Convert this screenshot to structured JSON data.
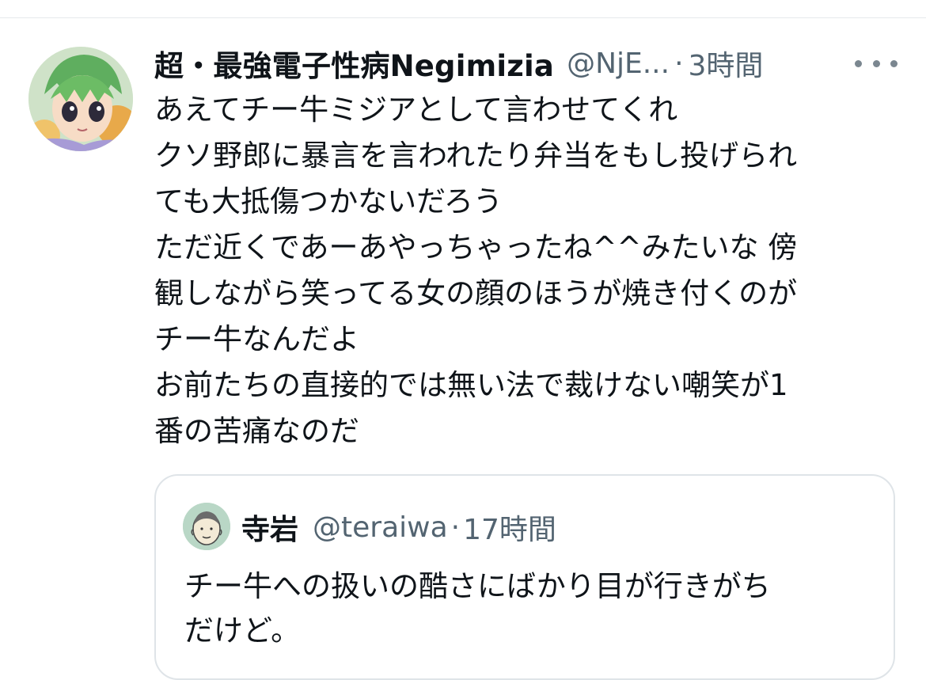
{
  "tweet": {
    "author": {
      "display_name": "超・最強電子性病Negimizia",
      "handle": "@NjE...",
      "avatar_icon": "anime-character-avatar-icon"
    },
    "separator": "·",
    "time": "3時間",
    "more_icon": "more-horizontal-icon",
    "text_lines": [
      "あえてチー牛ミジアとして言わせてくれ",
      "クソ野郎に暴言を言われたり弁当をもし投げられ",
      "ても大抵傷つかないだろう",
      "ただ近くであーあやっちゃったね^^みたいな 傍",
      "観しながら笑ってる女の顔のほうが焼き付くのが",
      "チー牛なんだよ",
      "お前たちの直接的では無い法で裁けない嘲笑が1",
      "番の苦痛なのだ"
    ]
  },
  "quoted_tweet": {
    "author": {
      "display_name": "寺岩",
      "handle": "@teraiwa",
      "avatar_icon": "cartoon-face-avatar-icon"
    },
    "separator": "·",
    "time": "17時間",
    "text_lines": [
      "チー牛への扱いの酷さにばかり目が行きがち",
      "だけど。"
    ]
  },
  "colors": {
    "primary_text": "#0f1419",
    "secondary_text": "#536471",
    "border": "#dfe4e8"
  }
}
